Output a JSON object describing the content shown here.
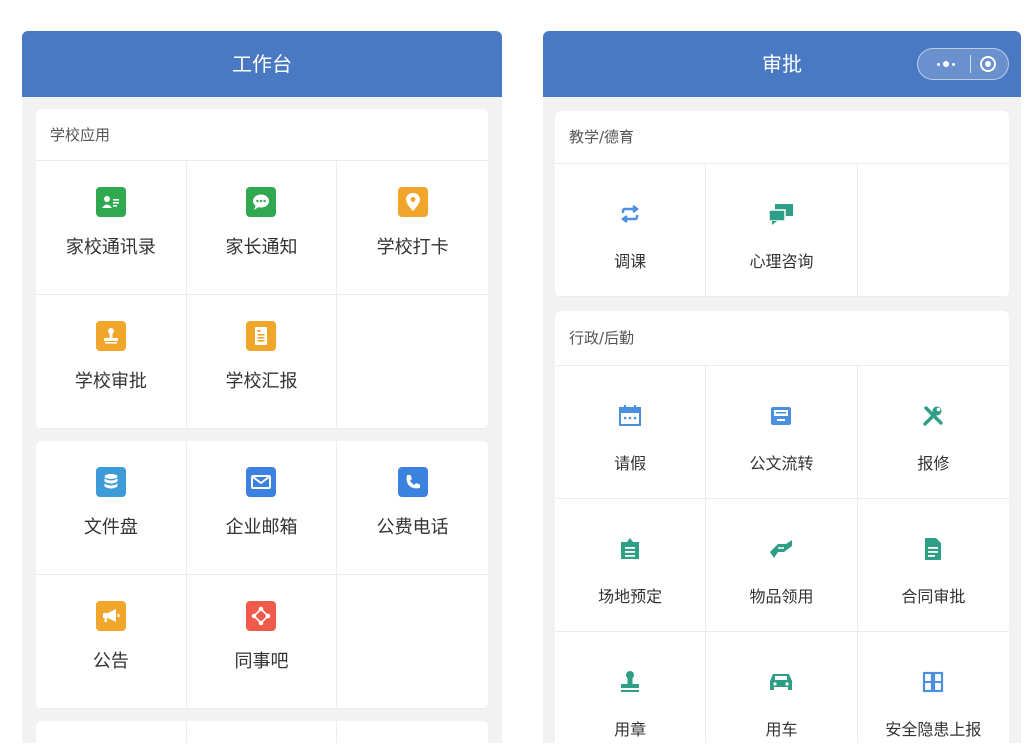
{
  "left_screen": {
    "header": {
      "title": "工作台"
    },
    "school_apps": {
      "title": "学校应用",
      "items": [
        {
          "label": "家校通讯录",
          "icon": "contact-card-icon",
          "color": "#2fa84f"
        },
        {
          "label": "家长通知",
          "icon": "chat-bubble-icon",
          "color": "#2fa84f"
        },
        {
          "label": "学校打卡",
          "icon": "location-pin-icon",
          "color": "#f0a62a"
        },
        {
          "label": "学校审批",
          "icon": "stamp-icon",
          "color": "#f0a62a"
        },
        {
          "label": "学校汇报",
          "icon": "report-doc-icon",
          "color": "#f0a62a"
        }
      ]
    },
    "general_apps": {
      "items": [
        {
          "label": "文件盘",
          "icon": "database-icon",
          "color": "#3d9bd8"
        },
        {
          "label": "企业邮箱",
          "icon": "mail-icon",
          "color": "#3b82e0"
        },
        {
          "label": "公费电话",
          "icon": "phone-icon",
          "color": "#3b82e0"
        },
        {
          "label": "公告",
          "icon": "megaphone-icon",
          "color": "#f0a62a"
        },
        {
          "label": "同事吧",
          "icon": "network-icon",
          "color": "#ef5a4b"
        }
      ]
    }
  },
  "right_screen": {
    "header": {
      "title": "审批"
    },
    "teaching": {
      "title": "教学/德育",
      "items": [
        {
          "label": "调课",
          "icon": "swap-cycle-icon",
          "color": "#4a8fe0"
        },
        {
          "label": "心理咨询",
          "icon": "chat-double-icon",
          "color": "#2e9e86"
        }
      ]
    },
    "admin": {
      "title": "行政/后勤",
      "items": [
        {
          "label": "请假",
          "icon": "calendar-icon",
          "color": "#4a8fe0"
        },
        {
          "label": "公文流转",
          "icon": "inbox-tray-icon",
          "color": "#4a8fe0"
        },
        {
          "label": "报修",
          "icon": "repair-tools-icon",
          "color": "#2e9e86"
        },
        {
          "label": "场地预定",
          "icon": "clipboard-icon",
          "color": "#2e9e86"
        },
        {
          "label": "物品领用",
          "icon": "hand-receive-icon",
          "color": "#2e9e86"
        },
        {
          "label": "合同审批",
          "icon": "contract-doc-icon",
          "color": "#2e9e86"
        },
        {
          "label": "用章",
          "icon": "seal-stamp-icon",
          "color": "#2e9e86"
        },
        {
          "label": "用车",
          "icon": "car-icon",
          "color": "#2e9e86"
        },
        {
          "label": "安全隐患上报",
          "icon": "grid-blocks-icon",
          "color": "#4a8fe0"
        }
      ]
    }
  }
}
